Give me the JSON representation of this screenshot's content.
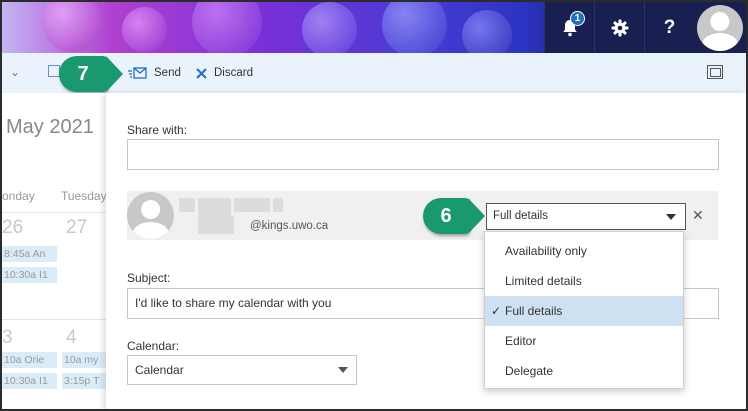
{
  "header": {
    "notification_count": "1",
    "icons": [
      "bell-icon",
      "gear-icon",
      "help-icon",
      "avatar"
    ]
  },
  "toolbar": {
    "send_label": "Send",
    "discard_label": "Discard"
  },
  "callouts": {
    "step_send": "7",
    "step_permission": "6"
  },
  "calendar_bg": {
    "month": "May 2021",
    "days": [
      "onday",
      "Tuesday"
    ],
    "dates": [
      "26",
      "27",
      "3",
      "4"
    ],
    "events": [
      "8:45a An",
      "10:30a I1",
      "10a Orie",
      "10:30a I1",
      "10a my",
      "3:15p T"
    ]
  },
  "share": {
    "share_with_label": "Share with:",
    "share_with_value": "",
    "person_email": "@kings.uwo.ca",
    "permission_selected": "Full details",
    "permission_options": [
      "Availability only",
      "Limited details",
      "Full details",
      "Editor",
      "Delegate"
    ],
    "selected_index": 2,
    "subject_label": "Subject:",
    "subject_value": "I'd like to share my calendar with you",
    "calendar_label": "Calendar:",
    "calendar_value": "Calendar"
  },
  "colors": {
    "callout": "#1a9970",
    "header_dark": "#1a1f52",
    "toolbar_bg": "#eaf2fb",
    "selected_option": "#cde1f3",
    "accent": "#1f6fc2"
  }
}
